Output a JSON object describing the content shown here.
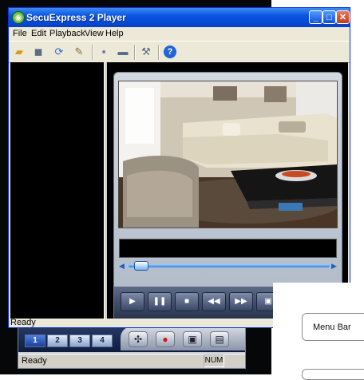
{
  "window": {
    "title": "SecuExpress 2 Player",
    "minimize_label": "_",
    "maximize_label": "□",
    "close_label": "✕"
  },
  "menu": [
    "File",
    "Edit",
    "Playback",
    "View",
    "Help"
  ],
  "toolbar": {
    "icons": [
      "open-folder-icon",
      "camera-icon",
      "refresh-icon",
      "edit-icon",
      "save-icon",
      "folder-icon",
      "settings-icon",
      "help-icon"
    ],
    "help_label": "?"
  },
  "status": {
    "text": "Ready"
  },
  "behind_window": {
    "channels": [
      "1",
      "2",
      "3",
      "4"
    ],
    "status_text": "Ready",
    "num_indicator": "NUM"
  },
  "player": {
    "controls": [
      "play-icon",
      "pause-icon",
      "stop-icon",
      "rewind-icon",
      "fast-forward-icon",
      "snapshot-icon"
    ],
    "control_glyphs": [
      "▶",
      "❚❚",
      "■",
      "◀◀",
      "▶▶",
      "▣"
    ],
    "seek_position": 0.03
  },
  "callout": {
    "label": "Menu Bar"
  }
}
